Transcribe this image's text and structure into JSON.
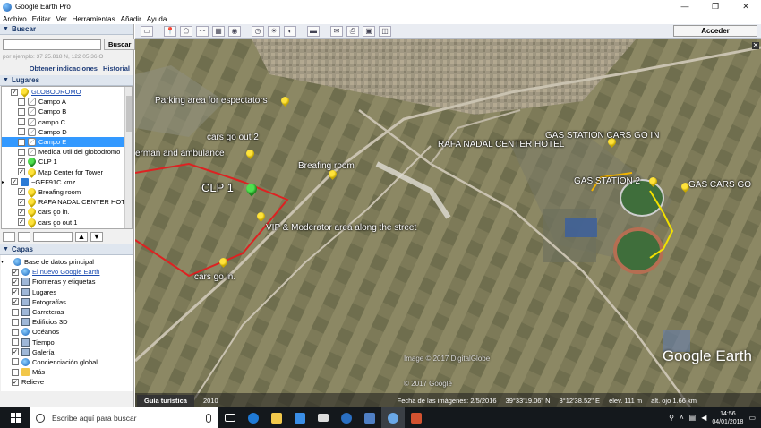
{
  "window": {
    "title": "Google Earth Pro"
  },
  "menu": [
    "Archivo",
    "Editar",
    "Ver",
    "Herramientas",
    "Añadir",
    "Ayuda"
  ],
  "search": {
    "header": "Buscar",
    "button": "Buscar",
    "placeholder": "",
    "hint": "por ejemplo: 37 25.818 N, 122 05.36 O",
    "link1": "Obtener indicaciones",
    "link2": "Historial"
  },
  "places": {
    "header": "Lugares",
    "items": [
      {
        "label": "GLOBODROMO",
        "icon": "pin-icon",
        "checked": true,
        "link": true
      },
      {
        "label": "Campo A",
        "icon": "path-icon",
        "checked": false
      },
      {
        "label": "Campo B",
        "icon": "path-icon",
        "checked": false
      },
      {
        "label": "campo C",
        "icon": "path-icon",
        "checked": false
      },
      {
        "label": "Campo D",
        "icon": "path-icon",
        "checked": false
      },
      {
        "label": "Campo E",
        "icon": "path-icon",
        "checked": true,
        "selected": true
      },
      {
        "label": "Medida Util del globodromo",
        "icon": "path-icon",
        "checked": false
      },
      {
        "label": "CLP 1",
        "icon": "green-pin-icon",
        "checked": true
      },
      {
        "label": "Map Center for Tower",
        "icon": "pin-icon",
        "checked": true
      },
      {
        "label": "~GEF91C.kmz",
        "icon": "kmz-icon",
        "checked": true
      },
      {
        "label": "Breafing room",
        "icon": "pin-icon",
        "checked": true
      },
      {
        "label": "RAFA NADAL CENTER HOT...",
        "icon": "pin-icon",
        "checked": true
      },
      {
        "label": "cars go in.",
        "icon": "pin-icon",
        "checked": true
      },
      {
        "label": "cars go out 1",
        "icon": "pin-icon",
        "checked": true
      }
    ]
  },
  "layers": {
    "header": "Capas",
    "items": [
      {
        "label": "Base de datos principal",
        "icon": "globe-icon"
      },
      {
        "label": "El nuevo Google Earth",
        "icon": "globe-icon",
        "checked": true,
        "link": true
      },
      {
        "label": "Fronteras y etiquetas",
        "icon": "borders-icon",
        "checked": true
      },
      {
        "label": "Lugares",
        "icon": "places-icon",
        "checked": true
      },
      {
        "label": "Fotografías",
        "icon": "photo-icon",
        "checked": true
      },
      {
        "label": "Carreteras",
        "icon": "roads-icon",
        "checked": false
      },
      {
        "label": "Edificios 3D",
        "icon": "buildings-icon",
        "checked": false
      },
      {
        "label": "Océanos",
        "icon": "ocean-icon",
        "checked": false
      },
      {
        "label": "Tiempo",
        "icon": "weather-icon",
        "checked": false
      },
      {
        "label": "Galería",
        "icon": "gallery-icon",
        "checked": true
      },
      {
        "label": "Concienciación global",
        "icon": "global-icon",
        "checked": false
      },
      {
        "label": "Más",
        "icon": "more-icon",
        "checked": false
      },
      {
        "label": "Relieve",
        "icon": "",
        "checked": true
      }
    ]
  },
  "toolbar": {
    "login": "Acceder"
  },
  "map": {
    "labels": [
      {
        "text": "Parking area for espectators"
      },
      {
        "text": "cars go out 2"
      },
      {
        "text": "erman and ambulance"
      },
      {
        "text": "Breafing room"
      },
      {
        "text": "RAFA NADAL CENTER HOTEL"
      },
      {
        "text": "GAS STATION CARS GO IN"
      },
      {
        "text": "GAS STATION 2"
      },
      {
        "text": "GAS CARS GO"
      },
      {
        "text": "CLP 1"
      },
      {
        "text": "VIP & Moderator area along the street"
      },
      {
        "text": "cars go in."
      }
    ],
    "watermark": "Google Earth",
    "copyright1": "Image © 2017 DigitalGlobe",
    "copyright2": "© 2017 Google"
  },
  "statusbar": {
    "tour": "Guía turística",
    "year": "2010",
    "imagery": "Fecha de las imágenes: 2/5/2016",
    "lat": "39°33'19.06\" N",
    "lon": "3°12'38.52\" E",
    "elev": "elev. 111 m",
    "eye": "alt. ojo 1.66 km"
  },
  "taskbar": {
    "search_placeholder": "Escribe aquí para buscar",
    "time": "14:56",
    "date": "04/01/2018"
  }
}
